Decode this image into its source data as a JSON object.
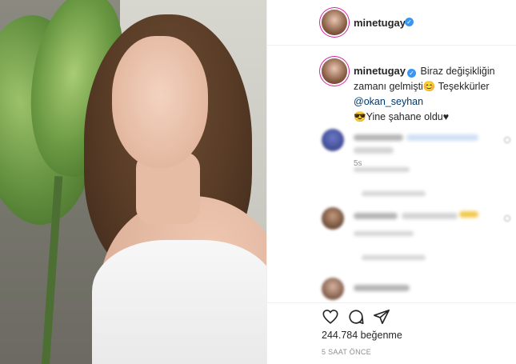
{
  "post": {
    "username": "minetugay",
    "verified_mark": "✓",
    "caption": {
      "text_part1": "Biraz değişikliğin zamanı gelmişti",
      "emoji1": "😊",
      "text_part2": " Teşekkürler ",
      "mention": "@okan_seyhan",
      "emoji2": "😎",
      "text_part3": "Yine şahane oldu",
      "emoji3": "♥",
      "time": "5s"
    },
    "likes": "244.784 beğenme",
    "timestamp": "5 SAAT ÖNCE"
  },
  "icons": {
    "like": "heart-icon",
    "comment": "comment-icon",
    "share": "share-icon",
    "verified": "verified-badge-icon"
  },
  "colors": {
    "verified": "#3897f0",
    "mention": "#00376b",
    "muted": "#8e8e8e",
    "text": "#262626"
  }
}
